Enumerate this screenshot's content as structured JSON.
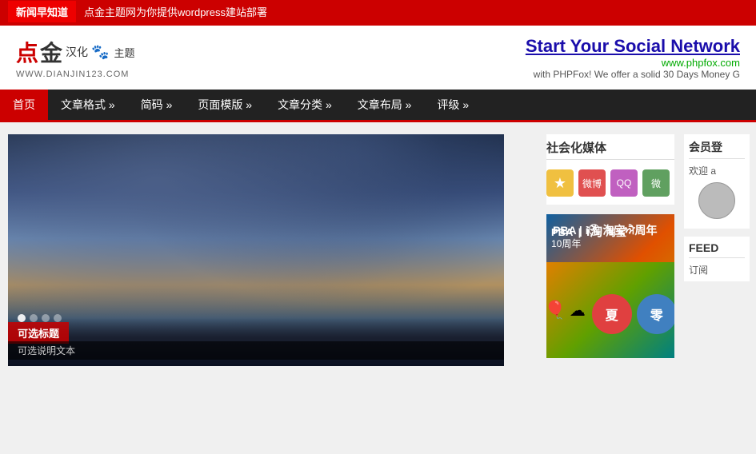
{
  "topbar": {
    "news_label": "新闻早知道",
    "slogan": "点金主题网为你提供wordpress建站部署"
  },
  "header": {
    "logo_dian": "点",
    "logo_jin": "金",
    "logo_hanhua": "汉化",
    "logo_paw": "🐾",
    "logo_zhuiti": "主题",
    "logo_url": "WWW.DIANJIN123.COM",
    "ad_title": "Start Your Social Network",
    "ad_url": "www.phpfox.com",
    "ad_desc": "with PHPFox! We offer a solid 30 Days Money G"
  },
  "nav": {
    "items": [
      {
        "label": "首页",
        "active": true
      },
      {
        "label": "文章格式 »",
        "active": false
      },
      {
        "label": "简码 »",
        "active": false
      },
      {
        "label": "页面模版 »",
        "active": false
      },
      {
        "label": "文章分类 »",
        "active": false
      },
      {
        "label": "文章布局 »",
        "active": false
      },
      {
        "label": "评级 »",
        "active": false
      }
    ]
  },
  "slideshow": {
    "dots": [
      {
        "active": true
      },
      {
        "active": false
      },
      {
        "active": false
      },
      {
        "active": false
      }
    ],
    "slide_title": "可选标题",
    "slide_subtitle": "可选说明文本"
  },
  "sidebar": {
    "social_title": "社会化媒体",
    "social_icons": [
      {
        "name": "star",
        "symbol": "★"
      },
      {
        "name": "weibo",
        "symbol": "微"
      },
      {
        "name": "qq",
        "symbol": "Q"
      },
      {
        "name": "wechat",
        "symbol": "微"
      }
    ],
    "ad_top_text": "PBA | i淘 淘宝\n10周年",
    "ad_summer": "夏",
    "ad_zero": "零"
  },
  "member": {
    "title": "会员登",
    "welcome": "欢迎 a",
    "feed_title": "FEED",
    "feed_subscribe": "订阅"
  }
}
